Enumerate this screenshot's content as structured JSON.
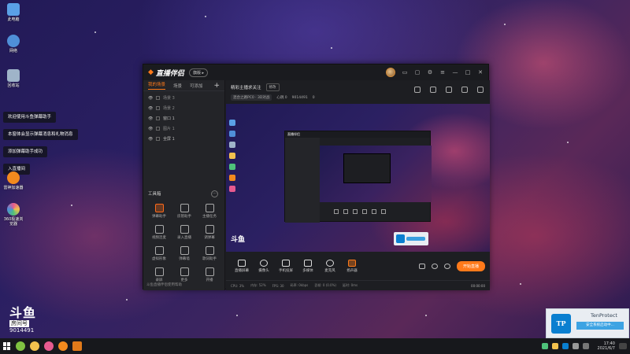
{
  "desktop": {
    "icons": [
      {
        "label": "此电脑",
        "color": "#5aa0e6"
      },
      {
        "label": "网络",
        "color": "#4f8fd8"
      },
      {
        "label": "回收站",
        "color": "#9fb4c9"
      },
      {
        "label": "雷神加速器",
        "color": "#f28a1e"
      },
      {
        "label": "360极速浏览器",
        "color": "#e65a8f"
      }
    ],
    "toasts": [
      "欢迎使用斗鱼弹幕助手",
      "本窗体会显示弹幕消息和礼物消息",
      "添加弹幕助手成功",
      "入直播间"
    ],
    "douyu": {
      "brand": "斗鱼",
      "sub": "房间号",
      "room_number": "9014491"
    }
  },
  "app": {
    "title": "直播伴侣",
    "version_pill": "旗版 ▸",
    "window_controls": [
      "▭",
      "▢",
      "⚙",
      "≡",
      "—",
      "□",
      "✕"
    ],
    "left_tabs": [
      "我的场景",
      "场景",
      "可添加"
    ],
    "add_symbol": "+",
    "scenes": [
      {
        "eye": "👁",
        "label": "场景 3"
      },
      {
        "eye": "👁",
        "label": "场景 2"
      },
      {
        "eye": "👁",
        "label": "窗口 1"
      },
      {
        "eye": "👁",
        "label": "图片 1"
      },
      {
        "eye": "👁",
        "label": "全屏 1"
      }
    ],
    "tools_title": "工具箱",
    "tools_more": "···",
    "tools": [
      "弹幕助手",
      "房管助手",
      "主播任务",
      "视频连麦",
      "录入直播",
      "调弹幕",
      "虚拟形象",
      "弹幕墙",
      "歌词助手",
      "录屏",
      "更多",
      "开播"
    ],
    "left_footer": "斗鱼直播伴侣使用帮助",
    "room_title": "精彩主播求关注",
    "edit_label": "修改",
    "meta": {
      "category": "混合之路PC0 · 3D对战",
      "hot": "心跳 0",
      "room_id": "9014491",
      "fans": "0"
    },
    "controls": [
      "直播屏幕",
      "摄像头",
      "手机投屏",
      "多媒体",
      "麦克风",
      "扬声器"
    ],
    "go_live": "开始直播",
    "status": [
      "CPU: 3%",
      "内存: 52%",
      "FPS: 30",
      "码率: 0kbps",
      "丢帧: 0 (0.0%)",
      "延时: 0ms"
    ],
    "status_time": "00:00:00"
  },
  "preview": {
    "logo": "斗鱼",
    "inner_title": "直播伴侣"
  },
  "tenprotect": {
    "name": "TenProtect",
    "logo": "TP",
    "status": "安全系统启动中..."
  },
  "taskbar": {
    "time": "17:40",
    "date": "2021/6/7"
  }
}
